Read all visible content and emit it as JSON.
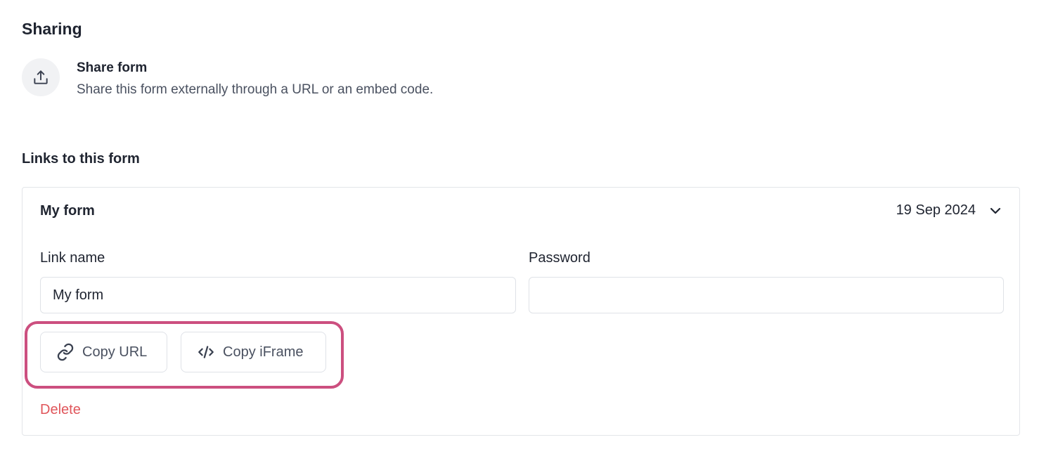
{
  "sharing": {
    "title": "Sharing",
    "share_form_title": "Share form",
    "share_form_desc": "Share this form externally through a URL or an embed code.",
    "share_icon": "upload-icon"
  },
  "links": {
    "title": "Links to this form",
    "card": {
      "name": "My form",
      "date": "19 Sep 2024",
      "chevron_icon": "chevron-down-icon",
      "link_name_label": "Link name",
      "link_name_value": "My form",
      "password_label": "Password",
      "password_value": "",
      "copy_url_label": "Copy URL",
      "copy_url_icon": "link-icon",
      "copy_iframe_label": "Copy iFrame",
      "copy_iframe_icon": "code-icon",
      "delete_label": "Delete"
    }
  },
  "colors": {
    "highlight": "#cc4f7f",
    "delete": "#e0565b",
    "text": "#1f2430",
    "muted": "#4a5160"
  }
}
